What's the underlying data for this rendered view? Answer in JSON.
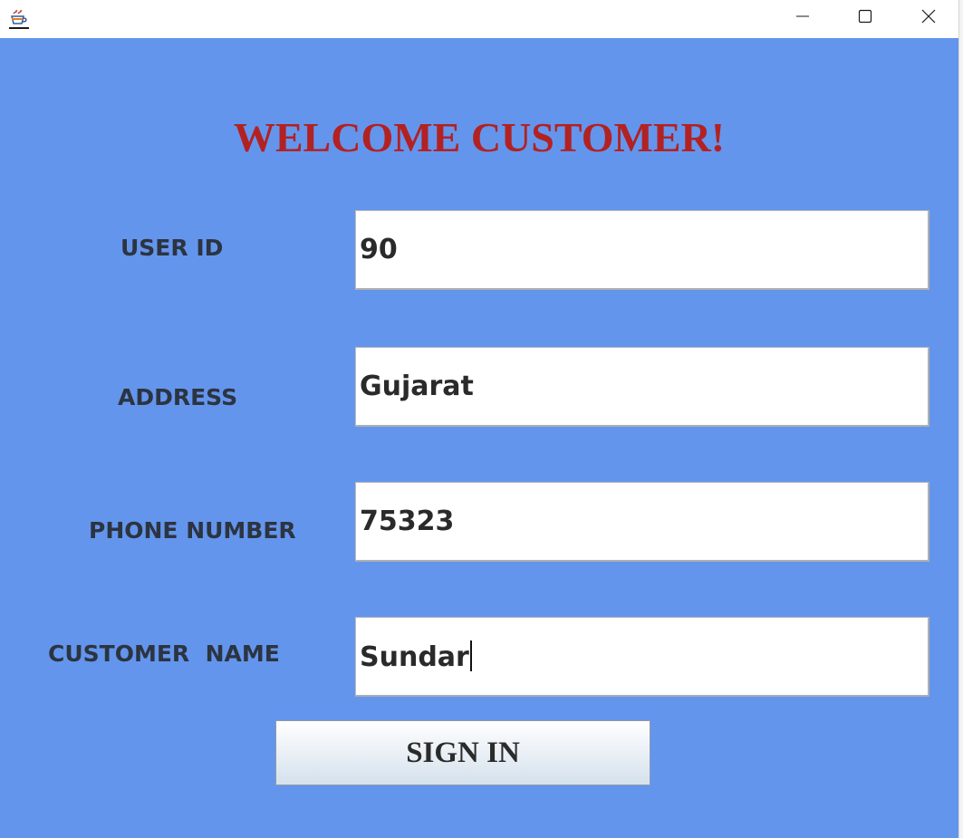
{
  "window": {
    "icon": "java-coffee-icon",
    "controls": [
      "minimize-icon",
      "maximize-icon",
      "close-icon"
    ]
  },
  "form": {
    "heading": "WELCOME CUSTOMER!",
    "fields": [
      {
        "label": "USER ID",
        "value": "90"
      },
      {
        "label": "ADDRESS",
        "value": "Gujarat"
      },
      {
        "label": "PHONE NUMBER",
        "value": "75323"
      },
      {
        "label": "CUSTOMER  NAME",
        "value": "Sundar"
      }
    ],
    "submit_label": "SIGN IN"
  },
  "colors": {
    "background": "#6495ED",
    "heading": "#B22222",
    "label": "#2b3440"
  }
}
